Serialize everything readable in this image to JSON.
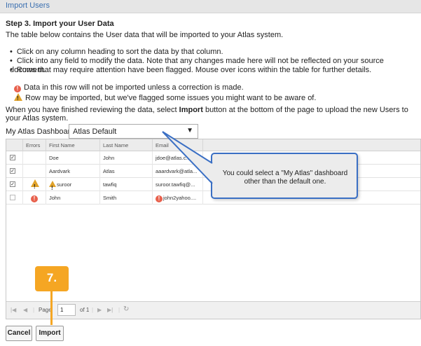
{
  "header": {
    "title": "Import Users"
  },
  "step": {
    "heading": "Step 3. Import your User Data",
    "intro": "The table below contains the User data that will be imported to your Atlas system.",
    "bullets": [
      "Click on any column heading to sort the data by that column.",
      "Click into any field to modify the data. Note that any changes made here will not be reflected on your source document.",
      "Rows that may require attention have been flagged. Mouse over icons within the table for further details."
    ],
    "legend_error": "Data in this row will not be imported unless a correction is made.",
    "legend_warning": "Row may be imported, but we've flagged some issues you might want to be aware of.",
    "finish_prefix": "When you have finished reviewing the data, select ",
    "finish_bold": "Import",
    "finish_suffix": " button at the bottom of the page to upload the new Users to your Atlas system."
  },
  "dashboard": {
    "label": "My Atlas Dashboard",
    "selected": "Atlas Default",
    "arrow": "▼"
  },
  "grid": {
    "columns": [
      "",
      "Errors",
      "First Name",
      "Last Name",
      "Email"
    ],
    "rows": [
      {
        "checked": true,
        "error": "",
        "first": "Doe",
        "last": "John",
        "email": "jdoe@atlas.c..."
      },
      {
        "checked": true,
        "error": "",
        "first": "Aardvark",
        "last": "Atlas",
        "email": "aaardvark@atla..."
      },
      {
        "checked": true,
        "error": "warning",
        "first": "suroor",
        "last": "tawfiq",
        "email": "suroor.tawfiq@..."
      },
      {
        "checked": false,
        "error": "error",
        "first": "John",
        "last": "Smith",
        "email": "john2yahoo...."
      }
    ],
    "pager": {
      "page_label": "Page",
      "page_value": "1",
      "of_label": "of 1"
    }
  },
  "buttons": {
    "cancel": "Cancel",
    "import": "Import"
  },
  "callout": {
    "text": "You could select a \"My Atlas\" dashboard other than the default one."
  },
  "step_badge": {
    "label": "7."
  },
  "colors": {
    "accent": "#3a6fc4",
    "badge": "#f5a623",
    "error": "#e8604c",
    "warning": "#e0a22a"
  }
}
